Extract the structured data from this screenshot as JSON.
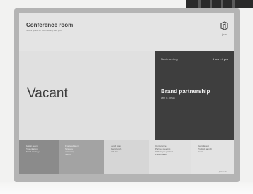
{
  "header": {
    "room_name": "Conference room",
    "room_sub": "Just a space for our meeting with you",
    "logo_text": "joan"
  },
  "status": {
    "text": "Vacant"
  },
  "next_meeting": {
    "label": "Next meeting",
    "time": "3 pm - 4 pm",
    "title": "Brand partnership",
    "subtitle": "with E. Tesla"
  },
  "timeline": [
    {
      "lines": [
        "Design team",
        "Presentation",
        "Brand strategy"
      ]
    },
    {
      "lines": [
        "Frontend team",
        "Strategy",
        "marketing",
        "Sprint"
      ]
    },
    {
      "lines": [
        "Lunch plan",
        "Team lunch",
        "with Ted"
      ]
    },
    {
      "lines": [
        "Conference",
        "Partner meeting",
        "Cyberdyne partner",
        "Presentation"
      ]
    },
    {
      "lines": [
        "Team Event",
        "Product launch",
        "Social"
      ]
    }
  ],
  "footer": {
    "text": "joan.com"
  },
  "colors": {
    "next_panel": "#3e3e3e",
    "status_panel": "#e0e0e0",
    "frame": "#b4b4b4"
  }
}
